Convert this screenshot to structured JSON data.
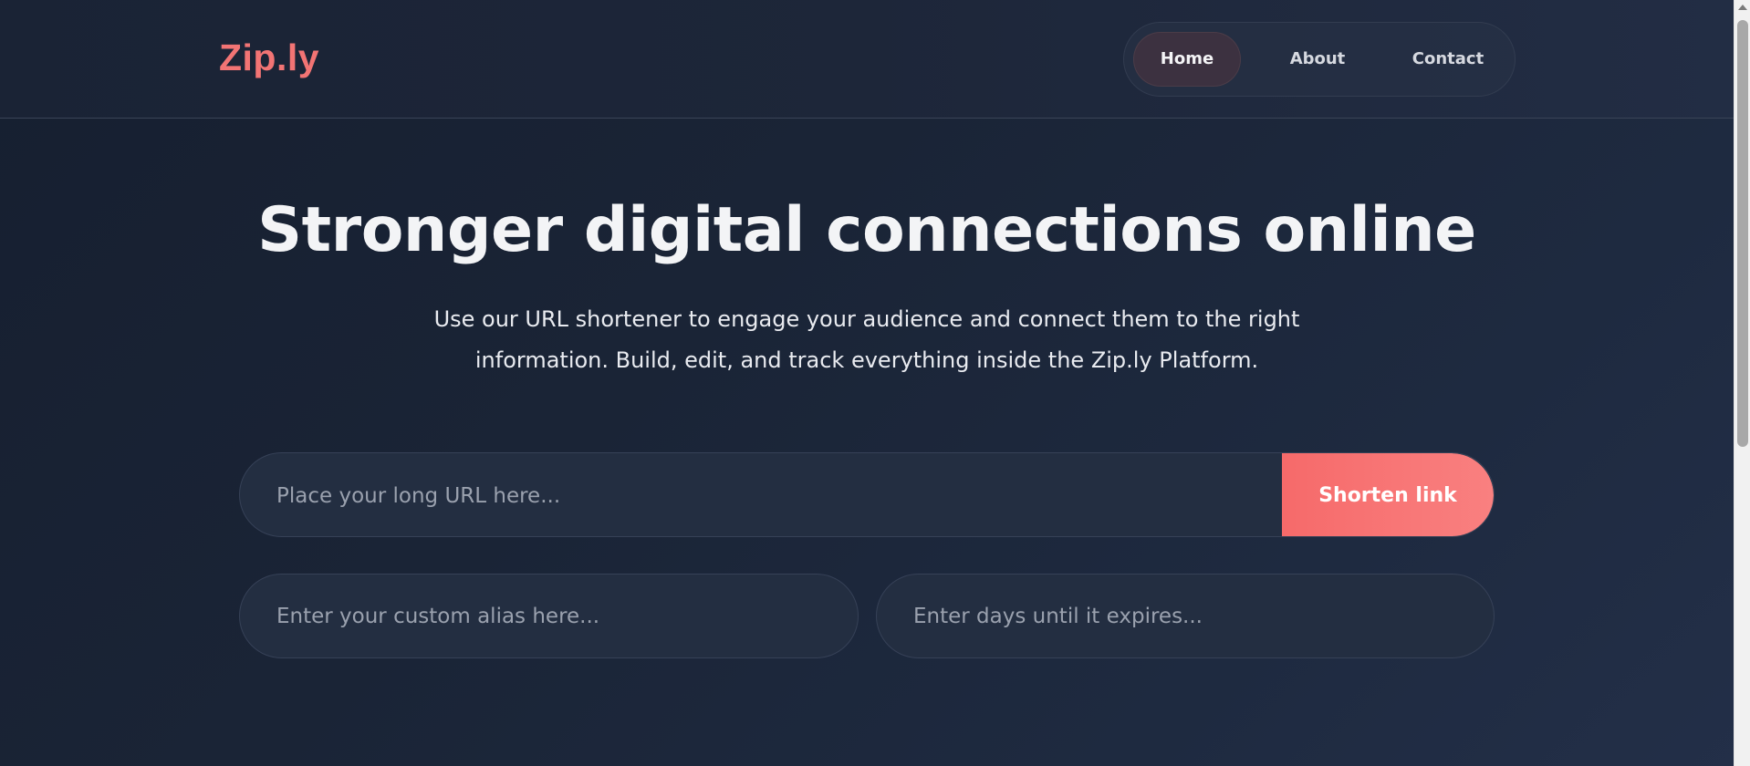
{
  "header": {
    "logo": "Zip.ly",
    "nav": [
      {
        "label": "Home",
        "active": true
      },
      {
        "label": "About",
        "active": false
      },
      {
        "label": "Contact",
        "active": false
      }
    ]
  },
  "hero": {
    "title": "Stronger digital connections online",
    "subtitle_line1": "Use our URL shortener to engage your audience and connect them to the right",
    "subtitle_line2": "information. Build, edit, and track everything inside the Zip.ly Platform."
  },
  "form": {
    "url_placeholder": "Place your long URL here...",
    "url_value": "",
    "shorten_label": "Shorten link",
    "alias_placeholder": "Enter your custom alias here...",
    "alias_value": "",
    "expiry_placeholder": "Enter days until it expires...",
    "expiry_value": ""
  },
  "colors": {
    "accent": "#f27474",
    "button": "#f87474",
    "background": "#1a2436",
    "field_bg": "#232e41"
  }
}
